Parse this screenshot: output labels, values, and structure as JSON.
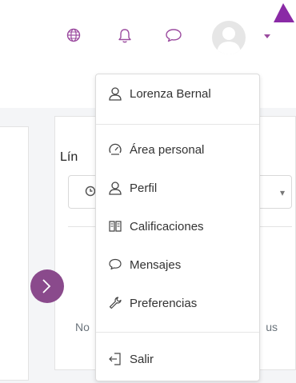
{
  "navbar": {
    "language_icon": "globe-icon",
    "notifications_icon": "bell-icon",
    "messages_icon": "chat-bubble-icon",
    "avatar_icon": "user-avatar-icon",
    "accent_color": "#9b4b9f"
  },
  "card": {
    "title": "Lín",
    "empty_left": "No",
    "empty_right": "us"
  },
  "user_menu": {
    "user_name": "Lorenza Bernal",
    "items": [
      {
        "label": "Área personal",
        "icon": "dashboard-gauge-icon"
      },
      {
        "label": "Perfil",
        "icon": "user-icon"
      },
      {
        "label": "Calificaciones",
        "icon": "book-icon"
      },
      {
        "label": "Mensajes",
        "icon": "chat-bubble-icon"
      },
      {
        "label": "Preferencias",
        "icon": "wrench-icon"
      }
    ],
    "logout": {
      "label": "Salir",
      "icon": "sign-out-icon"
    }
  }
}
